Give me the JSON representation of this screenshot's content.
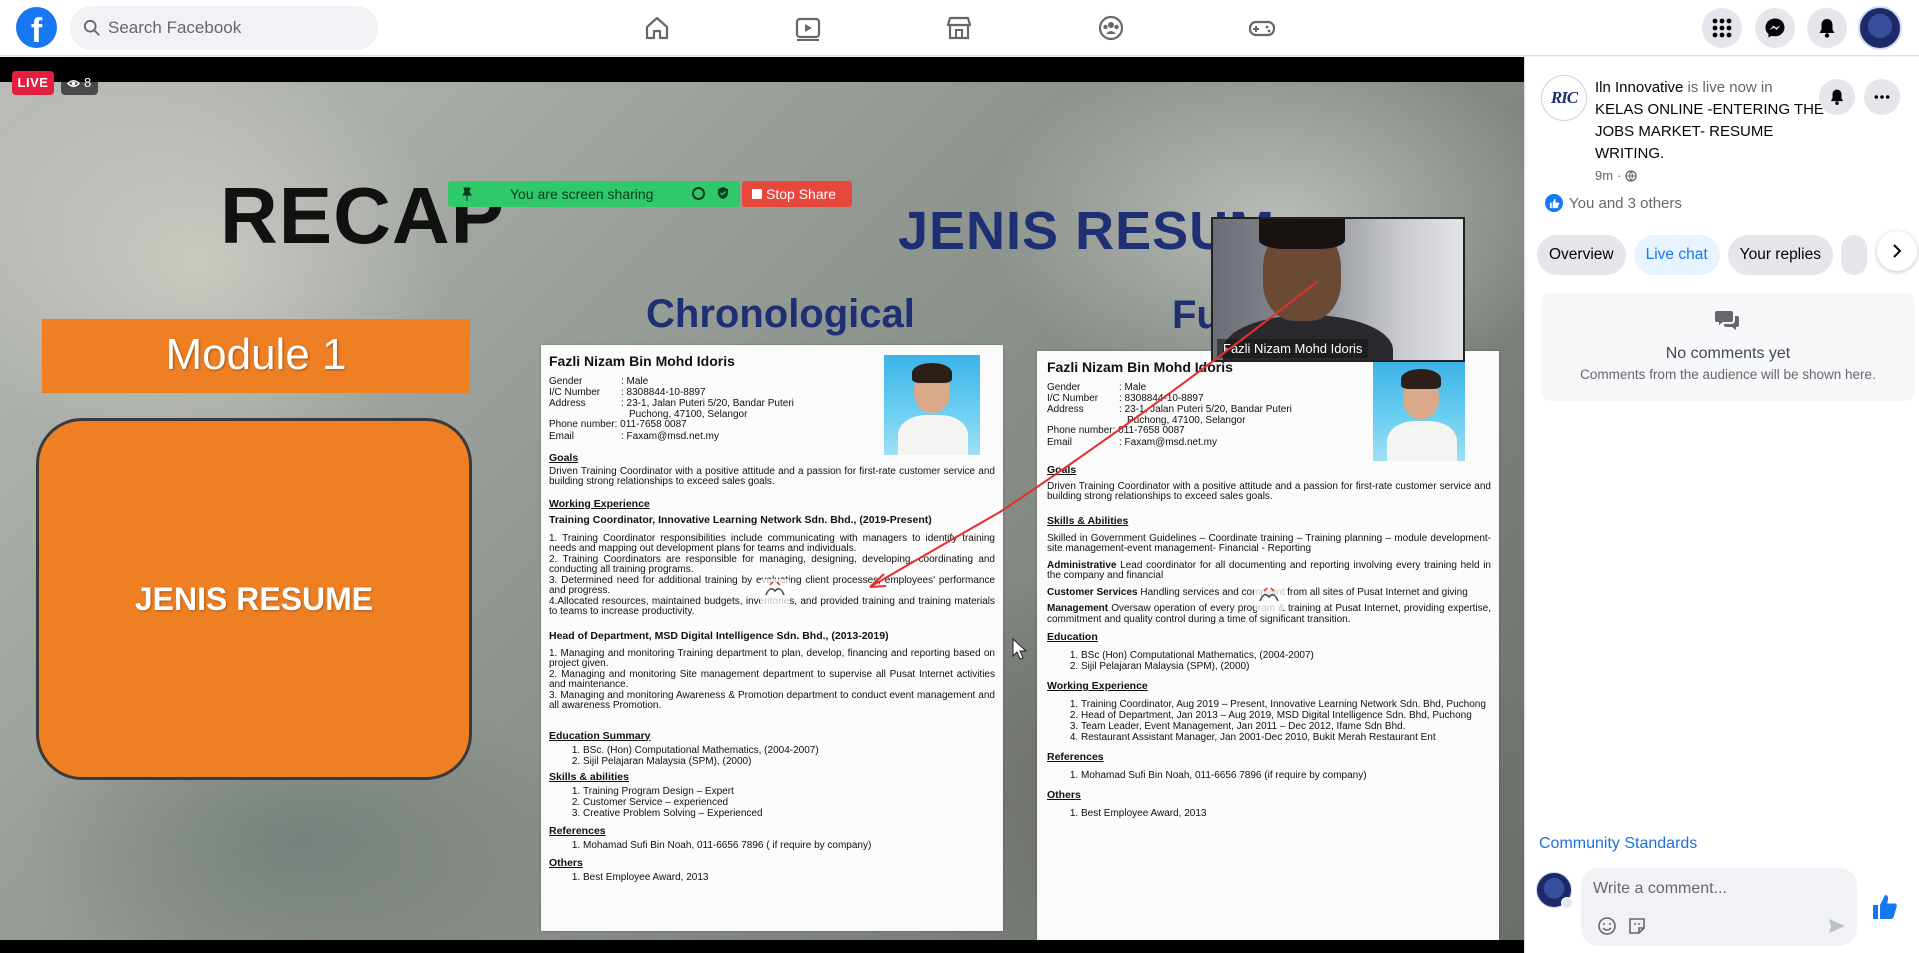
{
  "app": {
    "search_placeholder": "Search Facebook"
  },
  "nav": {
    "tabs": [
      {
        "name": "home",
        "icon": "home-icon"
      },
      {
        "name": "watch",
        "icon": "video-icon"
      },
      {
        "name": "marketplace",
        "icon": "store-icon"
      },
      {
        "name": "groups",
        "icon": "groups-icon"
      },
      {
        "name": "gaming",
        "icon": "gamepad-icon"
      }
    ],
    "right": [
      "menu-grid-icon",
      "messenger-icon",
      "bell-icon",
      "profile-avatar"
    ]
  },
  "video": {
    "live_label": "LIVE",
    "viewer_count": "8",
    "slide": {
      "recap": "RECAP",
      "share_text": "You are screen sharing",
      "stop_share": "Stop Share",
      "jenis_title": "JENIS RESUM",
      "chrono_label": "Chronological",
      "fu_label": "Fu",
      "module": "Module 1",
      "jenis_box": "JENIS RESUME"
    },
    "cam_name": "Fazli Nizam Mohd Idoris",
    "resume_a": {
      "name": "Fazli Nizam Bin Mohd Idoris",
      "gender_k": "Gender",
      "gender_v": ": Male",
      "ic_k": "I/C Number",
      "ic_v": ": 8308844-10-8897",
      "addr_k": "Address",
      "addr_v": ": 23-1, Jalan Puteri 5/20, Bandar Puteri",
      "addr_v2": "Puchong, 47100, Selangor",
      "phone": "Phone number: 011-7658 0087",
      "email_k": "Email",
      "email_v": ": Faxam@msd.net.my",
      "goals_h": "Goals",
      "goals": "Driven Training Coordinator with a positive attitude and a passion for first-rate customer service and building strong relationships to exceed sales goals.",
      "work_h": "Working Experience",
      "job1": "Training Coordinator, Innovative Learning Network Sdn. Bhd., (2019-Present)",
      "job1_p1": "1. Training Coordinator responsibilities include communicating with managers to identify training needs and mapping out development plans for teams and individuals.",
      "job1_p2": "2. Training Coordinators are responsible for managing, designing, developing, coordinating and conducting all training programs.",
      "job1_p3": "3. Determined need for additional training by evaluating client processes, employees' performance and progress.",
      "job1_p4": "4.Allocated resources, maintained budgets, inventories, and provided training and training materials to teams to increase productivity.",
      "job2": "Head of Department, MSD Digital Intelligence Sdn. Bhd., (2013-2019)",
      "job2_p1": "1. Managing and monitoring Training department to plan, develop, financing and reporting based on project given.",
      "job2_p2": "2. Managing and monitoring Site management department to supervise all Pusat Internet activities and maintenance.",
      "job2_p3": "3. Managing and monitoring Awareness & Promotion department to conduct event management and all awareness Promotion.",
      "edu_h": "Education Summary",
      "edu1": "BSc. (Hon) Computational Mathematics, (2004-2007)",
      "edu2": "Sijil Pelajaran Malaysia (SPM), (2000)",
      "skills_h": "Skills & abilities",
      "sk1": "Training Program Design – Expert",
      "sk2": "Customer Service – experienced",
      "sk3": "Creative Problem Solving – Experienced",
      "ref_h": "References",
      "ref1": "Mohamad Sufi Bin Noah, 011-6656 7896 ( if require by company)",
      "oth_h": "Others",
      "oth1": "Best Employee Award, 2013"
    },
    "resume_b": {
      "name": "Fazli Nizam Bin Mohd Idoris",
      "gender_k": "Gender",
      "gender_v": ": Male",
      "ic_k": "I/C Number",
      "ic_v": ": 8308844-10-8897",
      "addr_k": "Address",
      "addr_v": ": 23-1, Jalan Puteri 5/20, Bandar Puteri",
      "addr_v2": "Puchong, 47100, Selangor",
      "phone": "Phone number: 011-7658 0087",
      "email_k": "Email",
      "email_v": ": Faxam@msd.net.my",
      "goals_h": "Goals",
      "goals": "Driven Training Coordinator with a positive attitude and a passion for first-rate customer service and building strong relationships to exceed sales goals.",
      "skills_h": "Skills & Abilities",
      "skills": "Skilled in Government Guidelines – Coordinate training – Training planning – module development-site management-event management- Financial - Reporting",
      "adm_k": "Administrative",
      "adm": " Lead coordinator for all documenting and reporting involving every training held in the company and financial",
      "cs_k": "Customer Services",
      "cs": " Handling services and complaint from all sites of Pusat Internet and giving",
      "mg_k": "Management",
      "mg": " Oversaw operation of every program & training at Pusat Internet, providing expertise, commitment and quality control during a time of significant transition.",
      "edu_h": "Education",
      "edu1": "BSc (Hon) Computational Mathematics, (2004-2007)",
      "edu2": "Sijil Pelajaran Malaysia (SPM), (2000)",
      "work_h": "Working Experience",
      "w1": "Training Coordinator, Aug 2019 – Present, Innovative Learning Network Sdn. Bhd, Puchong",
      "w2": "Head of Department, Jan 2013 – Aug 2019, MSD Digital Intelligence Sdn. Bhd, Puchong",
      "w3": "Team Leader, Event Management, Jan 2011 – Dec 2012, Ifame Sdn Bhd.",
      "w4": "Restaurant Assistant Manager, Jan 2001-Dec 2010, Bukit Merah Restaurant Ent",
      "ref_h": "References",
      "ref1": "Mohamad Sufi Bin Noah, 011-6656 7896 (if require by company)",
      "oth_h": "Others",
      "oth1": "Best Employee Award, 2013"
    }
  },
  "panel": {
    "page_avatar_text": "RIC",
    "page_name": "Iln Innovative",
    "live_text": " is live now in",
    "event": "KELAS ONLINE -ENTERING THE JOBS MARKET- RESUME WRITING.",
    "time": "9m",
    "reactions": "You and 3 others",
    "tabs": [
      "Overview",
      "Live chat",
      "Your replies"
    ],
    "empty_title": "No comments yet",
    "empty_sub": "Comments from the audience will be shown here.",
    "community": "Community Standards",
    "comment_placeholder": "Write a comment..."
  },
  "colors": {
    "brand": "#1877f2",
    "live": "#e41e3f",
    "orange": "#ef7f23",
    "navy": "#1e2f73"
  }
}
